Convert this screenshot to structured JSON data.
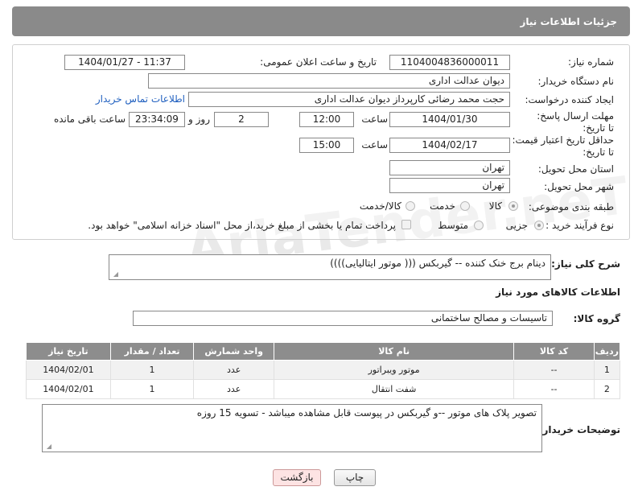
{
  "header": {
    "title": "جزئیات اطلاعات نیاز"
  },
  "watermark": "AriaTender.neT",
  "fields": {
    "need_number_label": "شماره نیاز:",
    "need_number": "1104004836000011",
    "announce_label": "تاریخ و ساعت اعلان عمومی:",
    "announce_value": "1404/01/27 - 11:37",
    "buyer_org_label": "نام دستگاه خریدار:",
    "buyer_org": "دیوان عدالت اداری",
    "requester_label": "ایجاد کننده درخواست:",
    "requester": "حجت محمد رضائی کارپرداز دیوان عدالت اداری",
    "contact_link": "اطلاعات تماس خریدار",
    "deadline_label": "مهلت ارسال پاسخ: تا تاریخ:",
    "deadline_date": "1404/01/30",
    "time_label": "ساعت",
    "deadline_time": "12:00",
    "days": "2",
    "days_label": "روز و",
    "remaining": "23:34:09",
    "remaining_label": "ساعت باقی مانده",
    "validity_label": "حداقل تاریخ اعتبار قیمت: تا تاریخ:",
    "validity_date": "1404/02/17",
    "validity_time": "15:00",
    "province_label": "استان محل تحویل:",
    "province": "تهران",
    "city_label": "شهر محل تحویل:",
    "city": "تهران",
    "category_label": "طبقه بندی موضوعی:",
    "category_options": [
      "کالا",
      "خدمت",
      "کالا/خدمت"
    ],
    "process_label": "نوع فرآیند خرید :",
    "process_options": [
      "جزیی",
      "متوسط"
    ],
    "payment_note": "پرداخت تمام یا بخشی از مبلغ خرید،از محل \"اسناد خزانه اسلامی\" خواهد بود."
  },
  "description": {
    "label": "شرح کلی نیاز:",
    "value": "دینام برج خنک کننده -- گیربکس ((( موتور ایتالیایی))))"
  },
  "goods_info_title": "اطلاعات کالاهای مورد نیاز",
  "goods_group": {
    "label": "گروه کالا:",
    "value": "تاسیسات و مصالح ساختمانی"
  },
  "table": {
    "headers": [
      "ردیف",
      "کد کالا",
      "نام کالا",
      "واحد شمارش",
      "تعداد / مقدار",
      "تاریخ نیاز"
    ],
    "rows": [
      [
        "1",
        "--",
        "موتور ویبراتور",
        "عدد",
        "1",
        "1404/02/01"
      ],
      [
        "2",
        "--",
        "شفت انتقال",
        "عدد",
        "1",
        "1404/02/01"
      ]
    ]
  },
  "buyer_notes": {
    "label": "توضیحات خریدار:",
    "value": "تصویر پلاک های موتور --و گیربکس در پیوست قابل مشاهده میباشد - تسویه 15 روزه"
  },
  "buttons": {
    "print": "چاپ",
    "back": "بازگشت"
  }
}
